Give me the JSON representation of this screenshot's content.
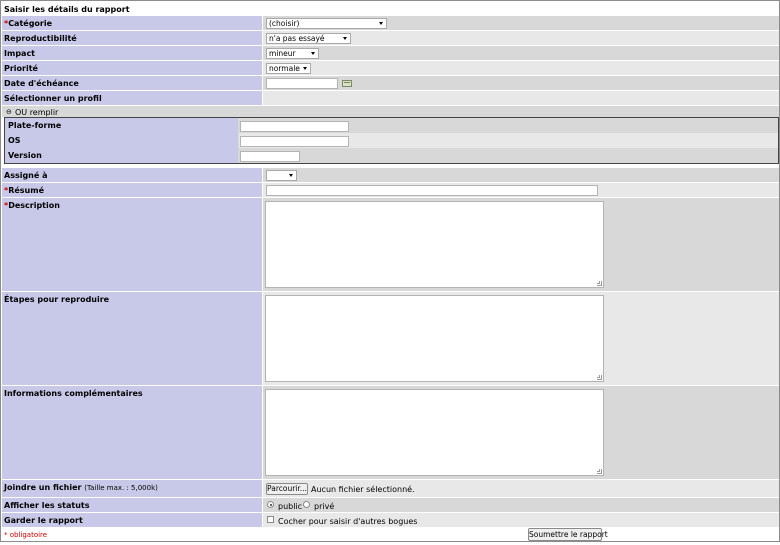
{
  "form": {
    "title": "Saisir les détails du rapport",
    "required_marker": "*",
    "fields": {
      "categorie": {
        "label": "Catégorie",
        "value": "(choisir)"
      },
      "reproductibilite": {
        "label": "Reproductibilité",
        "value": "n'a pas essayé"
      },
      "impact": {
        "label": "Impact",
        "value": "mineur"
      },
      "priorite": {
        "label": "Priorité",
        "value": "normale"
      },
      "date_echeance": {
        "label": "Date d'échéance",
        "value": ""
      },
      "profil": {
        "label": "Sélectionner un profil"
      },
      "ou_remplir": {
        "label": "OU remplir",
        "toggle": "⊖"
      },
      "plateforme": {
        "label": "Plate-forme",
        "value": ""
      },
      "os": {
        "label": "OS",
        "value": ""
      },
      "version": {
        "label": "Version",
        "value": ""
      },
      "assigne": {
        "label": "Assigné à",
        "value": ""
      },
      "resume": {
        "label": "Résumé",
        "value": ""
      },
      "description": {
        "label": "Description",
        "value": ""
      },
      "etapes": {
        "label": "Étapes pour reproduire",
        "value": ""
      },
      "informations": {
        "label": "Informations complémentaires",
        "value": ""
      },
      "fichier": {
        "label": "Joindre un fichier",
        "max_size": "(Taille max. : 5,000k)",
        "button": "Parcourir...",
        "status": "Aucun fichier sélectionné."
      },
      "statuts": {
        "label": "Afficher les statuts",
        "option_public": "public",
        "option_prive": "privé",
        "selected": "public"
      },
      "garder": {
        "label": "Garder le rapport",
        "checkbox_label": "Cocher pour saisir d'autres bogues",
        "checked": false
      }
    },
    "footer": {
      "required_note": "* obligatoire",
      "submit": "Soumettre le rapport"
    }
  },
  "colors": {
    "label_bg": "#c8c8e8",
    "row_dark": "#d8d8d8",
    "row_light": "#e8e8e8",
    "required": "#cc0000"
  }
}
